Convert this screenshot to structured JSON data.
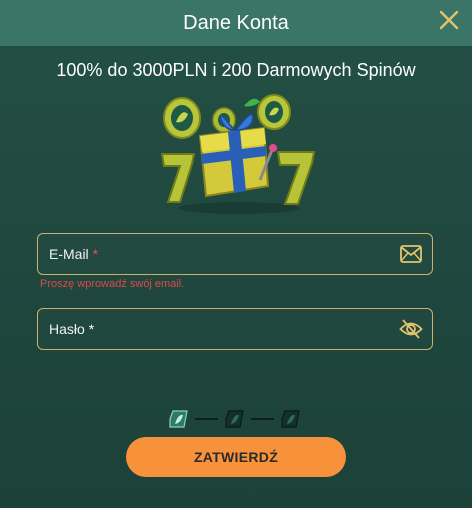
{
  "modal": {
    "title": "Dane Konta",
    "promo": "100% do 3000PLN i 200 Darmowych Spinów"
  },
  "form": {
    "email": {
      "label": "E-Mail",
      "required": "*",
      "value": "",
      "error": "Proszę wprowadź swój email.",
      "icon": "envelope-icon"
    },
    "password": {
      "label": "Hasło",
      "required": "*",
      "value": "",
      "icon": "eye-slash-icon"
    }
  },
  "steps": {
    "total": 3,
    "current": 1
  },
  "submit_label": "ZATWIERDŹ",
  "colors": {
    "header": "#3a7568",
    "accent": "#f7923a",
    "field_border": "#c9b36a",
    "error": "#e04848"
  }
}
